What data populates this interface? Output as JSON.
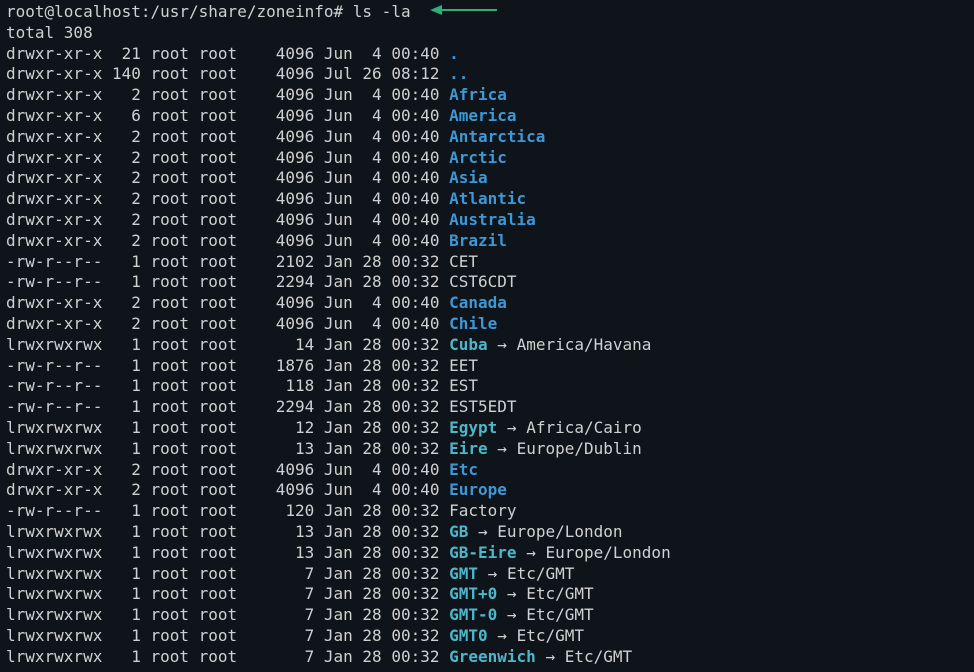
{
  "prompt": "root@localhost:/usr/share/zoneinfo# ",
  "command": "ls -la",
  "total_line": "total 308",
  "colors": {
    "bg": "#0e1419",
    "fg": "#d0d0d0",
    "dir": "#3e97d6",
    "symlink": "#4fb6c9",
    "arrow_annotation": "#2fae77"
  },
  "entries": [
    {
      "perm": "drwxr-xr-x",
      "links": 21,
      "owner": "root",
      "group": "root",
      "size": 4096,
      "date": "Jun  4 00:40",
      "name": ".",
      "kind": "dir"
    },
    {
      "perm": "drwxr-xr-x",
      "links": 140,
      "owner": "root",
      "group": "root",
      "size": 4096,
      "date": "Jul 26 08:12",
      "name": "..",
      "kind": "dir"
    },
    {
      "perm": "drwxr-xr-x",
      "links": 2,
      "owner": "root",
      "group": "root",
      "size": 4096,
      "date": "Jun  4 00:40",
      "name": "Africa",
      "kind": "dir"
    },
    {
      "perm": "drwxr-xr-x",
      "links": 6,
      "owner": "root",
      "group": "root",
      "size": 4096,
      "date": "Jun  4 00:40",
      "name": "America",
      "kind": "dir"
    },
    {
      "perm": "drwxr-xr-x",
      "links": 2,
      "owner": "root",
      "group": "root",
      "size": 4096,
      "date": "Jun  4 00:40",
      "name": "Antarctica",
      "kind": "dir"
    },
    {
      "perm": "drwxr-xr-x",
      "links": 2,
      "owner": "root",
      "group": "root",
      "size": 4096,
      "date": "Jun  4 00:40",
      "name": "Arctic",
      "kind": "dir"
    },
    {
      "perm": "drwxr-xr-x",
      "links": 2,
      "owner": "root",
      "group": "root",
      "size": 4096,
      "date": "Jun  4 00:40",
      "name": "Asia",
      "kind": "dir"
    },
    {
      "perm": "drwxr-xr-x",
      "links": 2,
      "owner": "root",
      "group": "root",
      "size": 4096,
      "date": "Jun  4 00:40",
      "name": "Atlantic",
      "kind": "dir"
    },
    {
      "perm": "drwxr-xr-x",
      "links": 2,
      "owner": "root",
      "group": "root",
      "size": 4096,
      "date": "Jun  4 00:40",
      "name": "Australia",
      "kind": "dir"
    },
    {
      "perm": "drwxr-xr-x",
      "links": 2,
      "owner": "root",
      "group": "root",
      "size": 4096,
      "date": "Jun  4 00:40",
      "name": "Brazil",
      "kind": "dir"
    },
    {
      "perm": "-rw-r--r--",
      "links": 1,
      "owner": "root",
      "group": "root",
      "size": 2102,
      "date": "Jan 28 00:32",
      "name": "CET",
      "kind": "file"
    },
    {
      "perm": "-rw-r--r--",
      "links": 1,
      "owner": "root",
      "group": "root",
      "size": 2294,
      "date": "Jan 28 00:32",
      "name": "CST6CDT",
      "kind": "file"
    },
    {
      "perm": "drwxr-xr-x",
      "links": 2,
      "owner": "root",
      "group": "root",
      "size": 4096,
      "date": "Jun  4 00:40",
      "name": "Canada",
      "kind": "dir"
    },
    {
      "perm": "drwxr-xr-x",
      "links": 2,
      "owner": "root",
      "group": "root",
      "size": 4096,
      "date": "Jun  4 00:40",
      "name": "Chile",
      "kind": "dir"
    },
    {
      "perm": "lrwxrwxrwx",
      "links": 1,
      "owner": "root",
      "group": "root",
      "size": 14,
      "date": "Jan 28 00:32",
      "name": "Cuba",
      "kind": "symlink",
      "target": "America/Havana"
    },
    {
      "perm": "-rw-r--r--",
      "links": 1,
      "owner": "root",
      "group": "root",
      "size": 1876,
      "date": "Jan 28 00:32",
      "name": "EET",
      "kind": "file"
    },
    {
      "perm": "-rw-r--r--",
      "links": 1,
      "owner": "root",
      "group": "root",
      "size": 118,
      "date": "Jan 28 00:32",
      "name": "EST",
      "kind": "file"
    },
    {
      "perm": "-rw-r--r--",
      "links": 1,
      "owner": "root",
      "group": "root",
      "size": 2294,
      "date": "Jan 28 00:32",
      "name": "EST5EDT",
      "kind": "file"
    },
    {
      "perm": "lrwxrwxrwx",
      "links": 1,
      "owner": "root",
      "group": "root",
      "size": 12,
      "date": "Jan 28 00:32",
      "name": "Egypt",
      "kind": "symlink",
      "target": "Africa/Cairo"
    },
    {
      "perm": "lrwxrwxrwx",
      "links": 1,
      "owner": "root",
      "group": "root",
      "size": 13,
      "date": "Jan 28 00:32",
      "name": "Eire",
      "kind": "symlink",
      "target": "Europe/Dublin"
    },
    {
      "perm": "drwxr-xr-x",
      "links": 2,
      "owner": "root",
      "group": "root",
      "size": 4096,
      "date": "Jun  4 00:40",
      "name": "Etc",
      "kind": "dir"
    },
    {
      "perm": "drwxr-xr-x",
      "links": 2,
      "owner": "root",
      "group": "root",
      "size": 4096,
      "date": "Jun  4 00:40",
      "name": "Europe",
      "kind": "dir"
    },
    {
      "perm": "-rw-r--r--",
      "links": 1,
      "owner": "root",
      "group": "root",
      "size": 120,
      "date": "Jan 28 00:32",
      "name": "Factory",
      "kind": "file"
    },
    {
      "perm": "lrwxrwxrwx",
      "links": 1,
      "owner": "root",
      "group": "root",
      "size": 13,
      "date": "Jan 28 00:32",
      "name": "GB",
      "kind": "symlink",
      "target": "Europe/London"
    },
    {
      "perm": "lrwxrwxrwx",
      "links": 1,
      "owner": "root",
      "group": "root",
      "size": 13,
      "date": "Jan 28 00:32",
      "name": "GB-Eire",
      "kind": "symlink",
      "target": "Europe/London"
    },
    {
      "perm": "lrwxrwxrwx",
      "links": 1,
      "owner": "root",
      "group": "root",
      "size": 7,
      "date": "Jan 28 00:32",
      "name": "GMT",
      "kind": "symlink",
      "target": "Etc/GMT"
    },
    {
      "perm": "lrwxrwxrwx",
      "links": 1,
      "owner": "root",
      "group": "root",
      "size": 7,
      "date": "Jan 28 00:32",
      "name": "GMT+0",
      "kind": "symlink",
      "target": "Etc/GMT"
    },
    {
      "perm": "lrwxrwxrwx",
      "links": 1,
      "owner": "root",
      "group": "root",
      "size": 7,
      "date": "Jan 28 00:32",
      "name": "GMT-0",
      "kind": "symlink",
      "target": "Etc/GMT"
    },
    {
      "perm": "lrwxrwxrwx",
      "links": 1,
      "owner": "root",
      "group": "root",
      "size": 7,
      "date": "Jan 28 00:32",
      "name": "GMT0",
      "kind": "symlink",
      "target": "Etc/GMT"
    },
    {
      "perm": "lrwxrwxrwx",
      "links": 1,
      "owner": "root",
      "group": "root",
      "size": 7,
      "date": "Jan 28 00:32",
      "name": "Greenwich",
      "kind": "symlink",
      "target": "Etc/GMT"
    }
  ]
}
